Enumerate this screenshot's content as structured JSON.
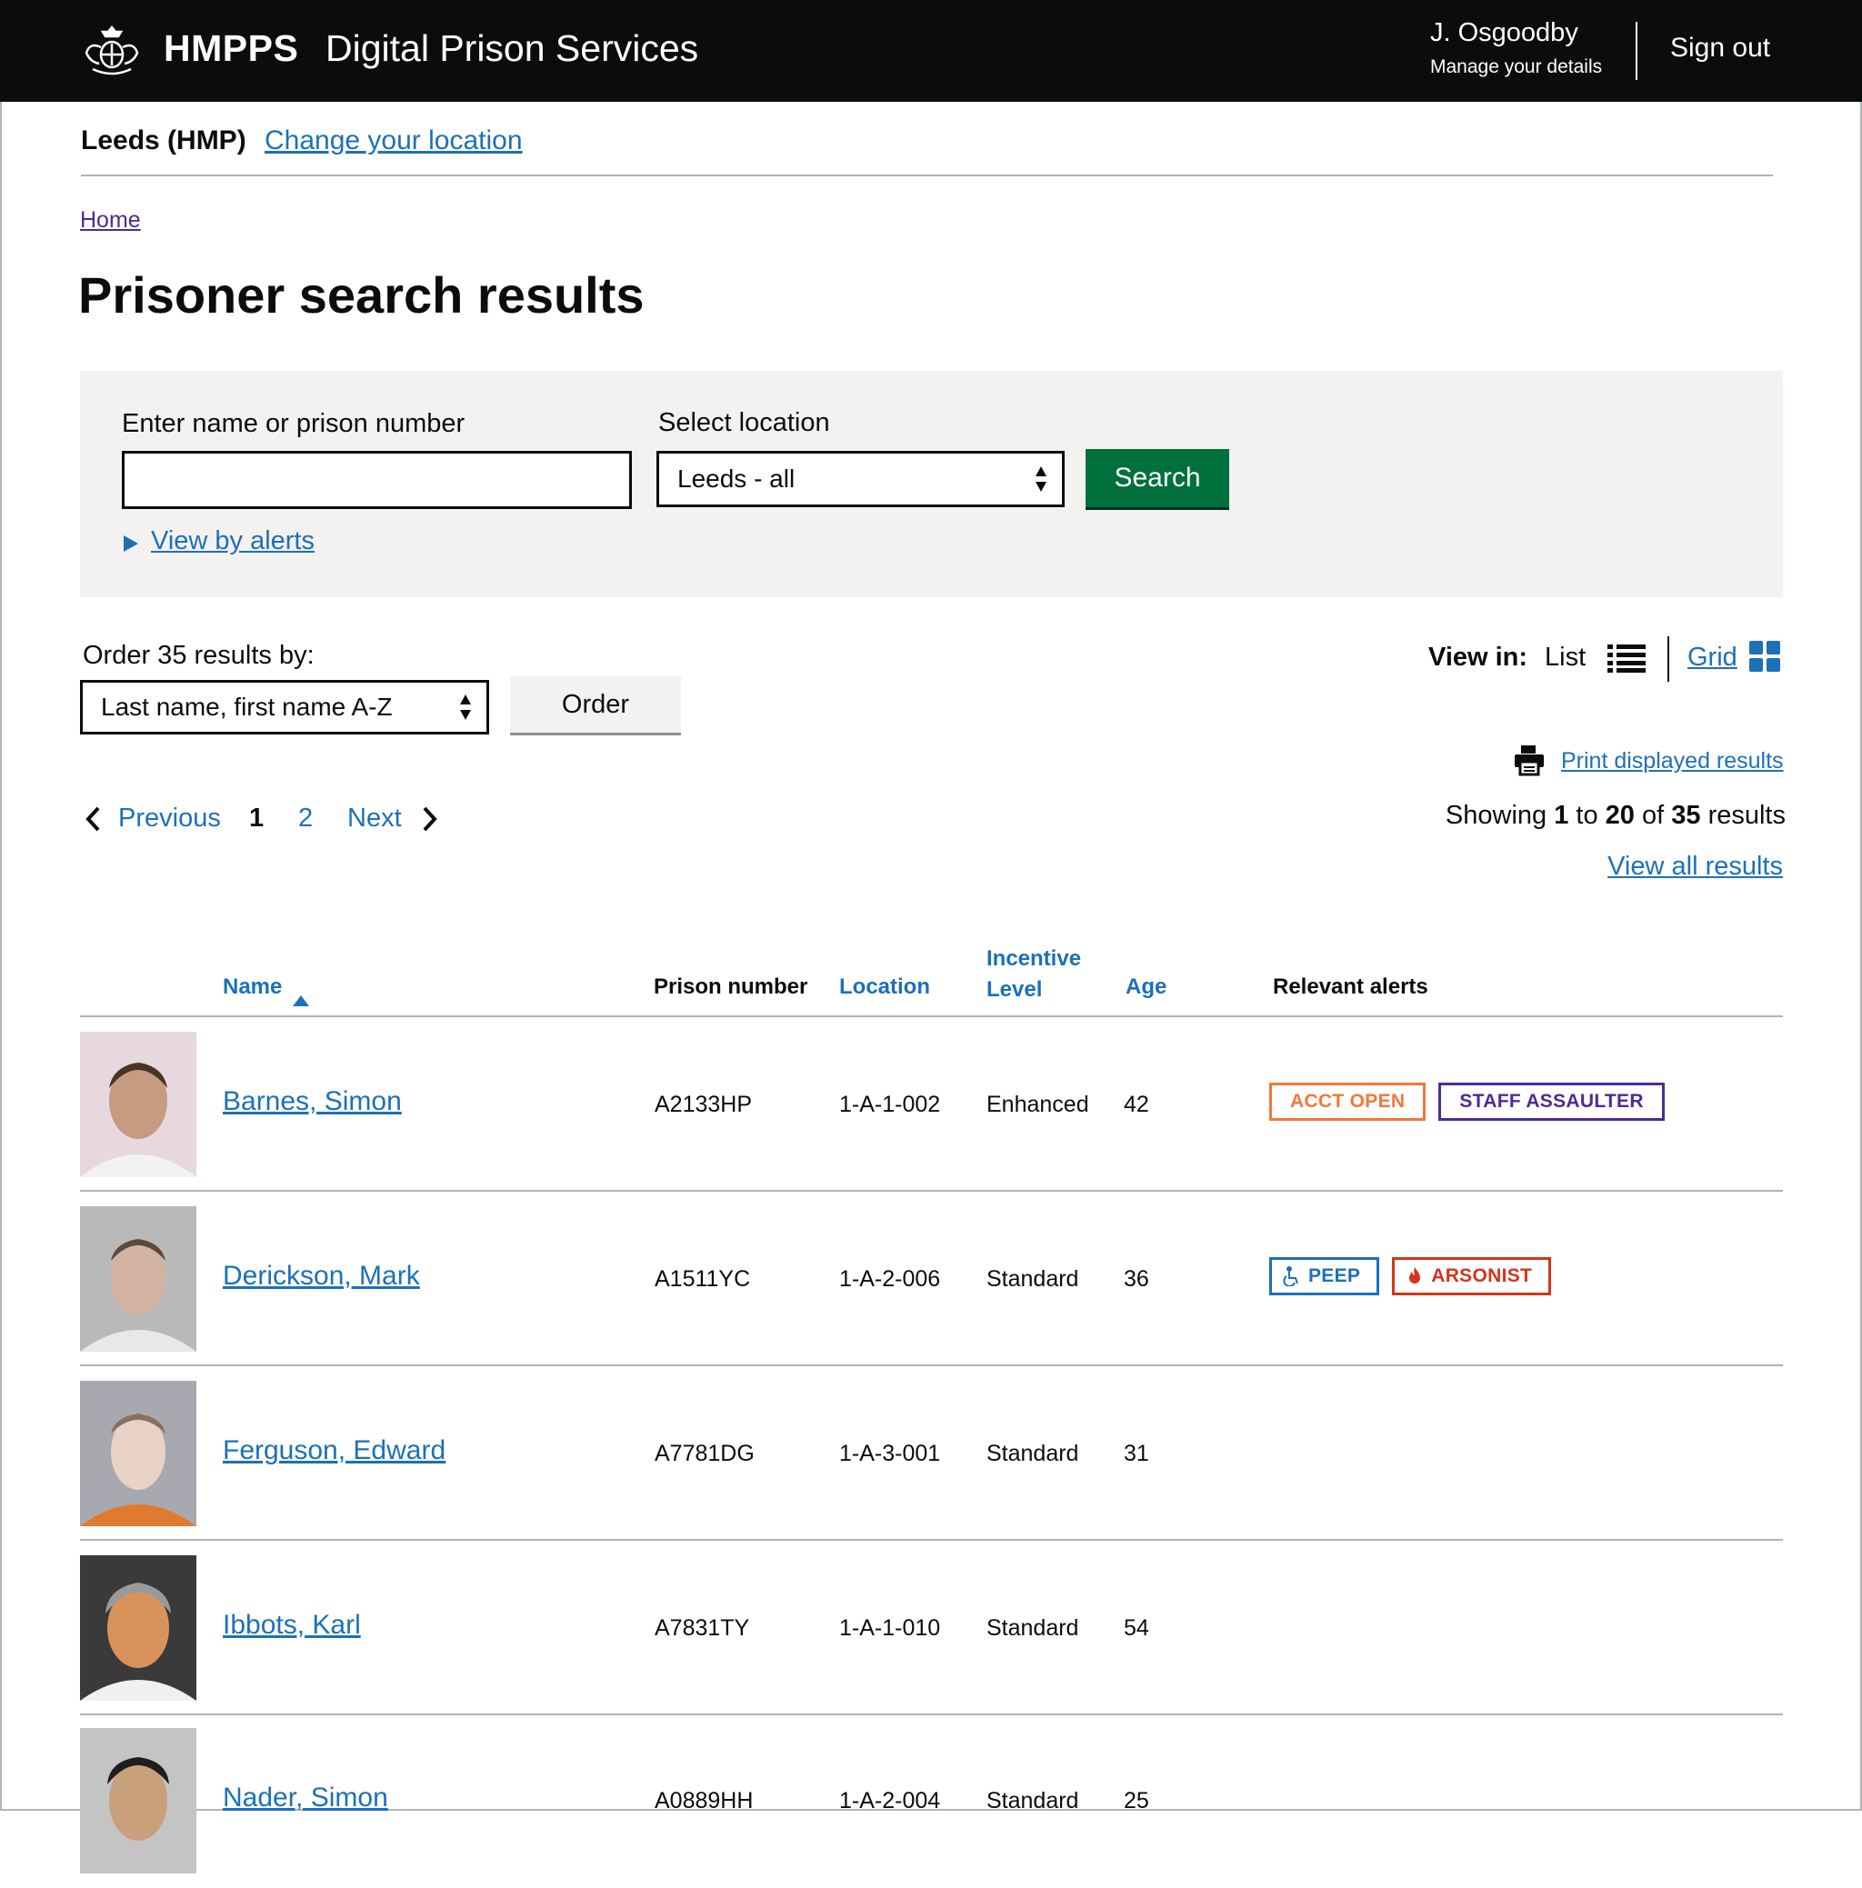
{
  "header": {
    "brand": "HMPPS",
    "service": "Digital Prison Services",
    "user_name": "J. Osgoodby",
    "manage_details": "Manage your details",
    "sign_out": "Sign out"
  },
  "location_bar": {
    "current": "Leeds (HMP)",
    "change_link": "Change your location"
  },
  "breadcrumb": {
    "home": "Home"
  },
  "page_title": "Prisoner search results",
  "search": {
    "name_label": "Enter name or prison number",
    "name_value": "",
    "location_label": "Select location",
    "location_selected": "Leeds - all",
    "search_button": "Search",
    "view_by_alerts": "View by alerts"
  },
  "order": {
    "label": "Order 35 results by:",
    "selected": "Last name, first name A-Z",
    "button": "Order"
  },
  "view_in": {
    "label": "View in:",
    "list": "List",
    "grid": "Grid"
  },
  "print_link": "Print displayed results",
  "pagination": {
    "previous": "Previous",
    "current": "1",
    "page2": "2",
    "next": "Next"
  },
  "showing": {
    "prefix": "Showing",
    "from": "1",
    "to_word": "to",
    "to": "20",
    "of_word": "of",
    "total": "35",
    "suffix": "results"
  },
  "view_all": "View all results",
  "table": {
    "headers": {
      "name": "Name",
      "prison_number": "Prison number",
      "location": "Location",
      "incentive_line1": "Incentive",
      "incentive_line2": "Level",
      "age": "Age",
      "alerts": "Relevant alerts"
    },
    "rows": [
      {
        "name": "Barnes, Simon",
        "prison_number": "A2133HP",
        "location": "1-A-1-002",
        "incentive": "Enhanced",
        "age": "42",
        "alerts": [
          {
            "label": "ACCT OPEN",
            "style": "orange",
            "icon": ""
          },
          {
            "label": "STAFF ASSAULTER",
            "style": "purple",
            "icon": ""
          }
        ]
      },
      {
        "name": "Derickson, Mark",
        "prison_number": "A1511YC",
        "location": "1-A-2-006",
        "incentive": "Standard",
        "age": "36",
        "alerts": [
          {
            "label": "PEEP",
            "style": "blue",
            "icon": "wheelchair-icon"
          },
          {
            "label": "ARSONIST",
            "style": "red",
            "icon": "flame-icon"
          }
        ]
      },
      {
        "name": "Ferguson, Edward",
        "prison_number": "A7781DG",
        "location": "1-A-3-001",
        "incentive": "Standard",
        "age": "31",
        "alerts": []
      },
      {
        "name": "Ibbots, Karl",
        "prison_number": "A7831TY",
        "location": "1-A-1-010",
        "incentive": "Standard",
        "age": "54",
        "alerts": []
      },
      {
        "name": "Nader, Simon",
        "prison_number": "A0889HH",
        "location": "1-A-2-004",
        "incentive": "Standard",
        "age": "25",
        "alerts": []
      }
    ]
  },
  "colors": {
    "header_bg": "#0b0c0c",
    "link": "#1d70b8",
    "visited_link": "#4c2c92",
    "button_green": "#00703c",
    "panel_bg": "#f3f2f1",
    "alert_orange": "#f47738",
    "alert_purple": "#4c2c92",
    "alert_blue": "#1d70b8",
    "alert_red": "#d4351c"
  }
}
